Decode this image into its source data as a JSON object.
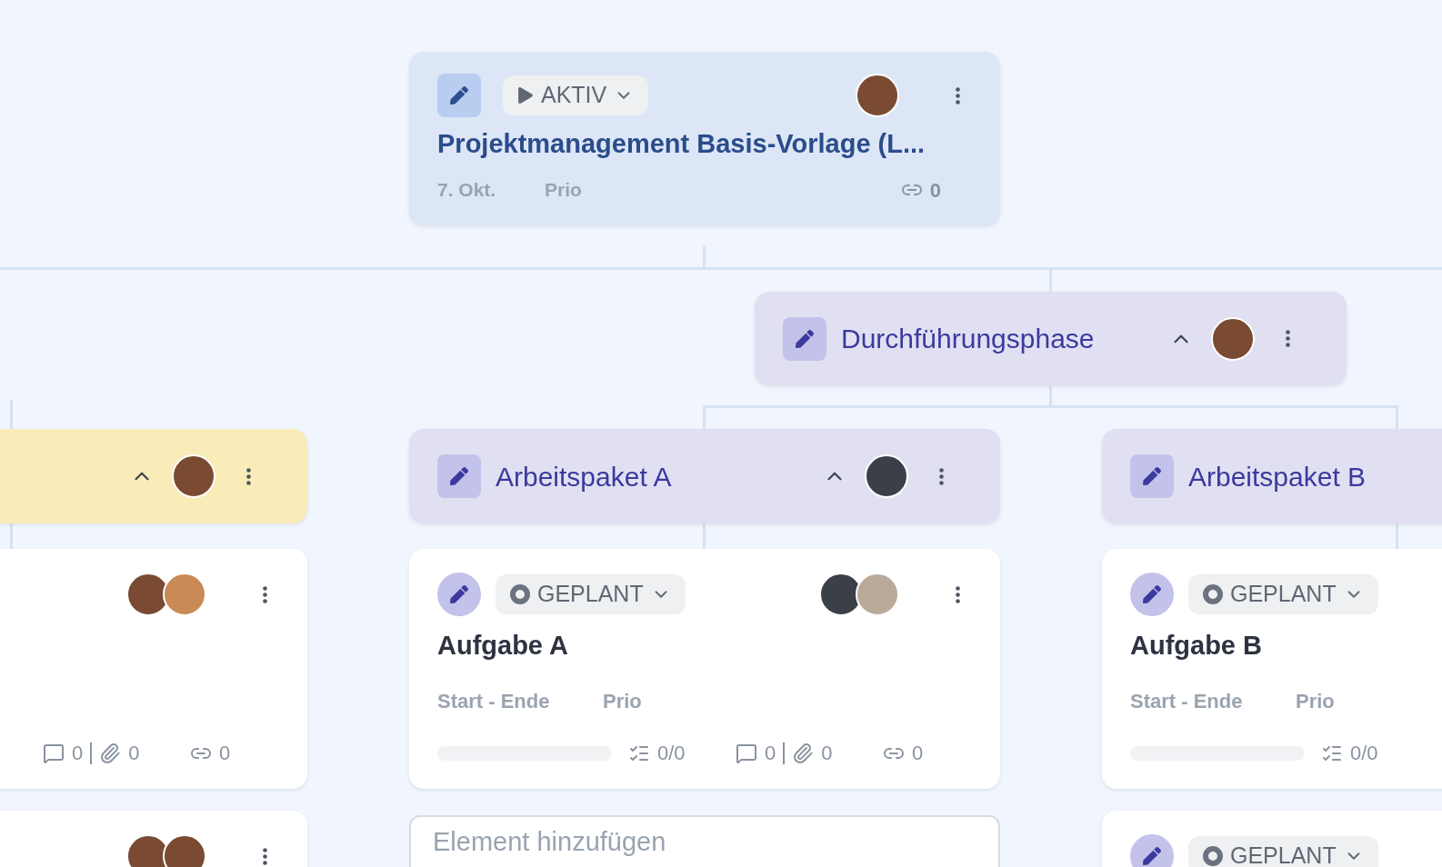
{
  "nodes": [
    {
      "kind": "project",
      "status": {
        "kind": "active",
        "label": "AKTIV"
      },
      "title": "Projektmanagement Basis-Vorlage (L...",
      "date": "7. Okt.",
      "prio": "Prio",
      "links": "0",
      "assignees": [
        {
          "color": "#7a4a32"
        }
      ]
    },
    {
      "kind": "phase",
      "title": "Durchführungsphase",
      "expanded": true,
      "assignees": [
        {
          "color": "#7a4a32"
        }
      ]
    },
    {
      "kind": "package",
      "color": "#f9ecb8",
      "expanded": true,
      "assignees": [
        {
          "color": "#7a4a32"
        }
      ]
    },
    {
      "kind": "package",
      "color": "#e0e0f2",
      "title": "Arbeitspaket A",
      "expanded": true,
      "assignees": [
        {
          "color": "#3b3f48"
        }
      ]
    },
    {
      "kind": "package",
      "color": "#e0e0f2",
      "title": "Arbeitspaket B"
    },
    {
      "kind": "task",
      "assignees": [
        {
          "color": "#7a4a32"
        },
        {
          "color": "#c98a55"
        }
      ],
      "comments": "0",
      "attachments": "0",
      "links": "0"
    },
    {
      "kind": "task",
      "status": {
        "kind": "planned",
        "label": "GEPLANT"
      },
      "title": "Aufgabe A",
      "dates": "Start - Ende",
      "prio": "Prio",
      "progress": {
        "level": 0
      },
      "checklist": "0/0",
      "comments": "0",
      "attachments": "0",
      "links": "0",
      "assignees": [
        {
          "color": "#3b3f48"
        },
        {
          "color": "#b9a999"
        }
      ]
    },
    {
      "kind": "task",
      "status": {
        "kind": "planned",
        "label": "GEPLANT"
      },
      "title": "Aufgabe B",
      "dates": "Start - Ende",
      "prio": "Prio",
      "progress": {
        "level": 0
      },
      "checklist": "0/0"
    },
    {
      "kind": "add",
      "placeholder": "Element hinzufügen"
    },
    {
      "kind": "task",
      "assignees": [
        {
          "color": "#7a4a32"
        },
        {
          "color": "#7a4a32"
        }
      ]
    },
    {
      "kind": "task",
      "status": {
        "kind": "planned",
        "label": "GEPLANT"
      }
    }
  ]
}
